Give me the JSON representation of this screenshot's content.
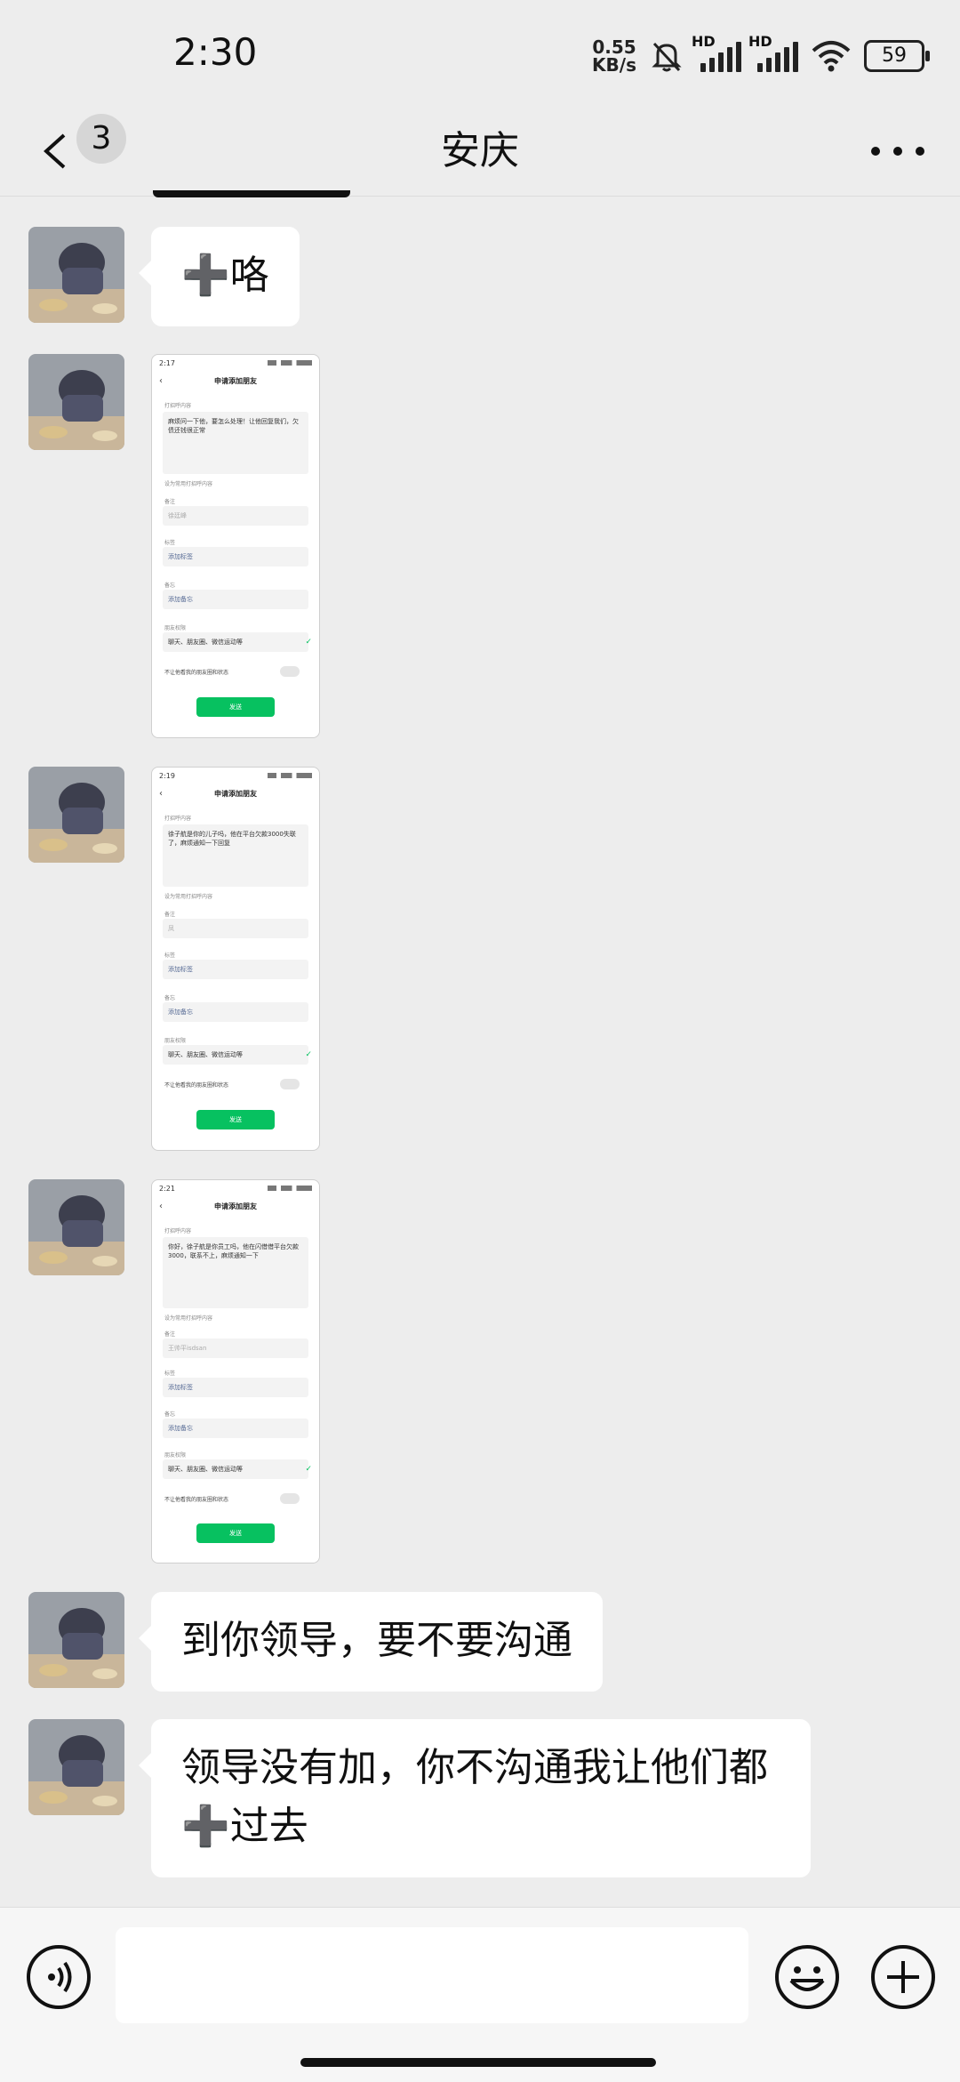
{
  "status_bar": {
    "time": "2:30",
    "net_speed_value": "0.55",
    "net_speed_unit": "KB/s",
    "signal_label_1": "HD",
    "signal_label_2": "HD",
    "battery": "59",
    "icons": [
      "mute-bell-icon",
      "signal-icon",
      "signal-icon",
      "wifi-icon",
      "battery-icon"
    ]
  },
  "header": {
    "unread_count": "3",
    "title": "安庆",
    "icons": [
      "back-chevron-icon",
      "more-icon"
    ]
  },
  "messages": [
    {
      "type": "text",
      "plus": "➕",
      "text": "咯"
    },
    {
      "type": "image",
      "shot": {
        "time": "2:17",
        "title": "申请添加朋友",
        "section1": "打招呼内容",
        "greeting": "麻烦问一下他，要怎么处理！让他回复我们，欠债还钱很正常",
        "section2": "设为常用打招呼内容",
        "remark_label": "备注",
        "remark_value": "徐廷峰",
        "tag_label": "标签",
        "tag_value": "添加标签",
        "desc_label": "备忘",
        "desc_value": "添加备忘",
        "perm_label": "朋友权限",
        "perm_value": "聊天、朋友圈、微信运动等",
        "hide_label": "不让他看我的朋友圈和状态",
        "send": "发送"
      }
    },
    {
      "type": "image",
      "shot": {
        "time": "2:19",
        "title": "申请添加朋友",
        "section1": "打招呼内容",
        "greeting": "徐子航是你的儿子吗，他在平台欠款3000失联了，麻烦通知一下回复",
        "section2": "设为常用打招呼内容",
        "remark_label": "备注",
        "remark_value": "凤",
        "tag_label": "标签",
        "tag_value": "添加标签",
        "desc_label": "备忘",
        "desc_value": "添加备忘",
        "perm_label": "朋友权限",
        "perm_value": "聊天、朋友圈、微信运动等",
        "hide_label": "不让他看我的朋友圈和状态",
        "send": "发送"
      }
    },
    {
      "type": "image",
      "shot": {
        "time": "2:21",
        "title": "申请添加朋友",
        "section1": "打招呼内容",
        "greeting": "你好，徐子航是你员工吗，他在闪借借平台欠款3000，联系不上，麻烦通知一下",
        "section2": "设为常用打招呼内容",
        "remark_label": "备注",
        "remark_value": "王帅平isdsan",
        "tag_label": "标签",
        "tag_value": "添加标签",
        "desc_label": "备忘",
        "desc_value": "添加备忘",
        "perm_label": "朋友权限",
        "perm_value": "聊天、朋友圈、微信运动等",
        "hide_label": "不让他看我的朋友圈和状态",
        "send": "发送"
      }
    },
    {
      "type": "text",
      "text": "到你领导，要不要沟通"
    },
    {
      "type": "text",
      "line1": "领导没有加，你不沟通我让他们都",
      "plus": "➕",
      "line2": "过去"
    }
  ],
  "input_bar": {
    "placeholder": "",
    "icons": [
      "voice-icon",
      "emoji-icon",
      "plus-circle-icon"
    ]
  }
}
